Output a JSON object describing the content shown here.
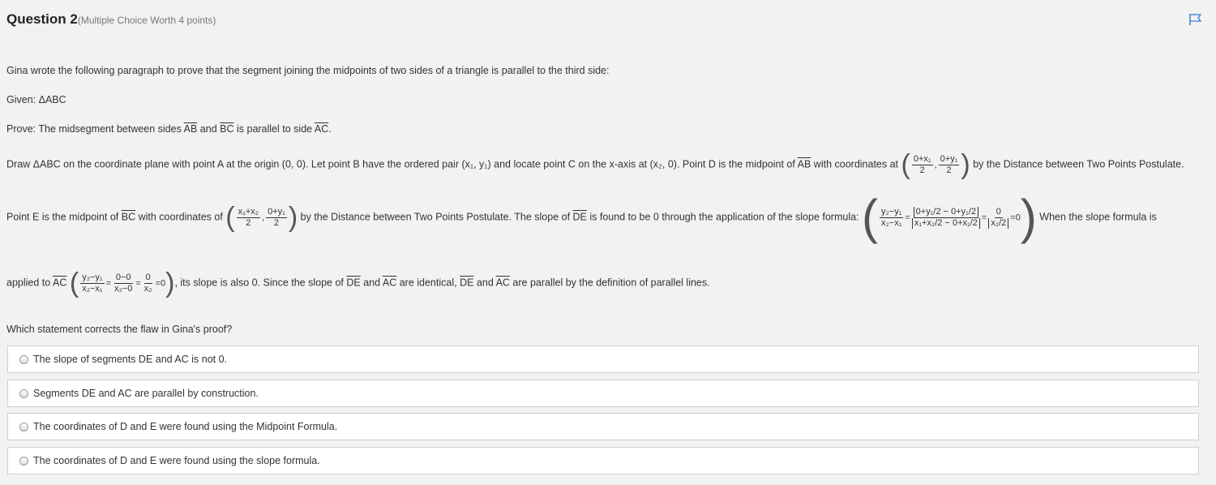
{
  "question": {
    "title": "Question 2",
    "subtitle": "(Multiple Choice Worth 4 points)"
  },
  "body": {
    "intro": "Gina wrote the following paragraph to prove that the segment joining the midpoints of two sides of a triangle is parallel to the third side:",
    "given": "Given: ΔABC",
    "prove_pre": "Prove: The midsegment between sides ",
    "ab": "AB",
    "and": " and ",
    "bc": "BC",
    "prove_mid": " is parallel to side ",
    "ac": "AC",
    "period": ".",
    "draw_text": "Draw ΔABC on the coordinate plane with point A at the origin (0, 0). Let point B have the ordered pair (x₁, y₁) and locate point C on the x-axis at (x₂, 0). Point D is the midpoint of ",
    "draw_text2": " with coordinates at ",
    "draw_text3": " by the Distance between Two Points Postulate.",
    "e_text1": "Point E is the midpoint of ",
    "e_text2": " with coordinates of ",
    "e_text3": " by the Distance between Two Points Postulate. The slope of ",
    "de": "DE",
    "e_text4": " is found to be 0 through the application of the slope formula: ",
    "e_text5": " When the slope formula is",
    "applied_pre": "applied to ",
    "applied_post": ", its slope is also 0. Since the slope of ",
    "applied_are": " are identical, ",
    "applied_end": " are parallel by the definition of parallel lines.",
    "which": "Which statement corrects the flaw in Gina's proof?"
  },
  "options": [
    "The slope of segments DE and AC is not 0.",
    "Segments DE and AC are parallel by construction.",
    "The coordinates of D and E were found using the Midpoint Formula.",
    "The coordinates of D and E were found using the slope formula."
  ],
  "icons": {
    "flag": "flag-icon"
  },
  "colors": {
    "accent": "#3a7bd5"
  }
}
